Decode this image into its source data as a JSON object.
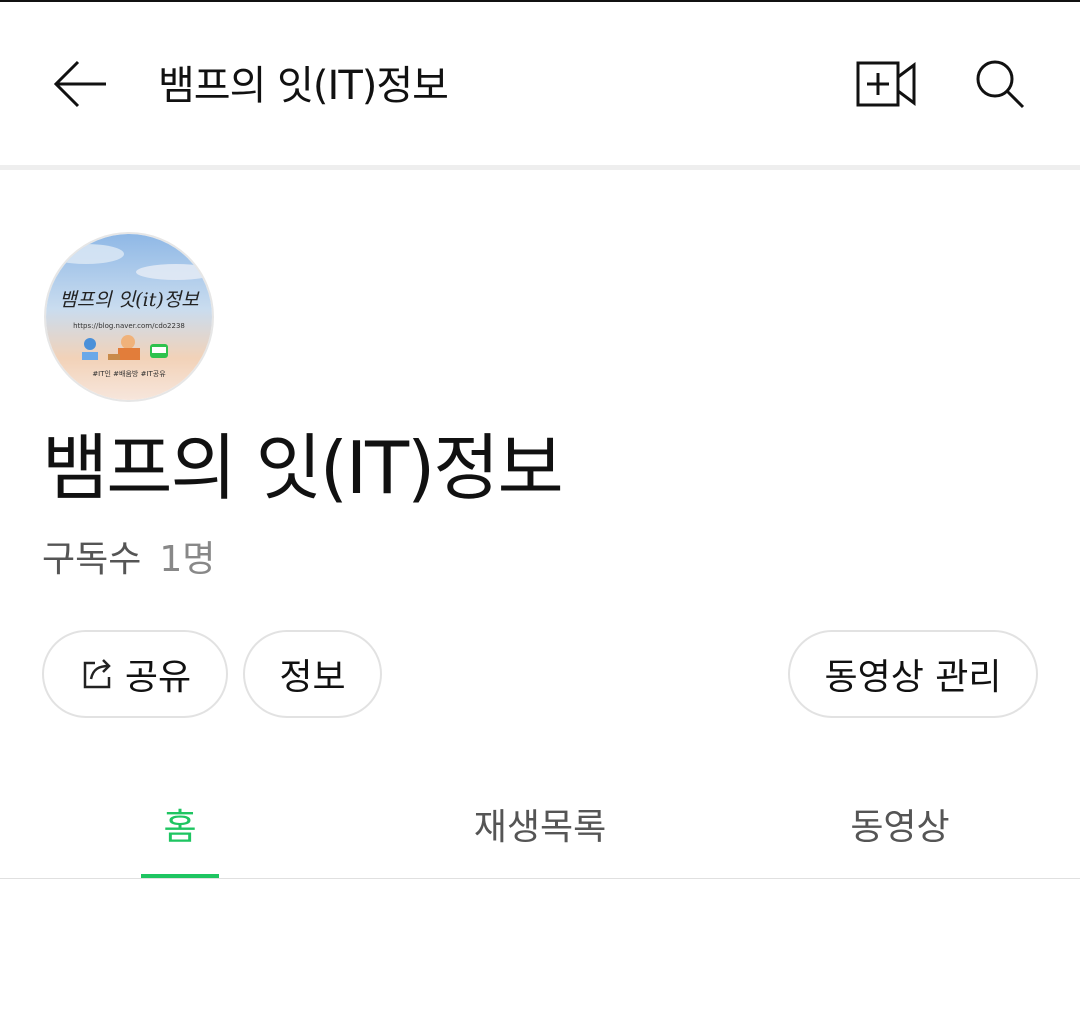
{
  "header": {
    "title": "뱀프의 잇(IT)정보",
    "back_icon": "arrow-left-icon",
    "add_video_icon": "add-video-icon",
    "search_icon": "search-icon"
  },
  "profile": {
    "avatar_icon": "channel-avatar",
    "avatar_text": "뱀프의 잇(it)정보",
    "avatar_url_text": "https://blog.naver.com/cdo2238",
    "avatar_tags": "#IT인 #배움방 #IT공유",
    "channel_name": "뱀프의 잇(IT)정보",
    "subscribers_label": "구독수",
    "subscribers_count": "1명"
  },
  "actions": {
    "share_label": "공유",
    "share_icon": "share-icon",
    "info_label": "정보",
    "manage_label": "동영상 관리"
  },
  "tabs": [
    {
      "label": "홈",
      "active": true
    },
    {
      "label": "재생목록",
      "active": false
    },
    {
      "label": "동영상",
      "active": false
    }
  ],
  "colors": {
    "accent": "#1ec561",
    "text": "#111111",
    "muted": "#888888",
    "border": "#e2e2e2"
  }
}
